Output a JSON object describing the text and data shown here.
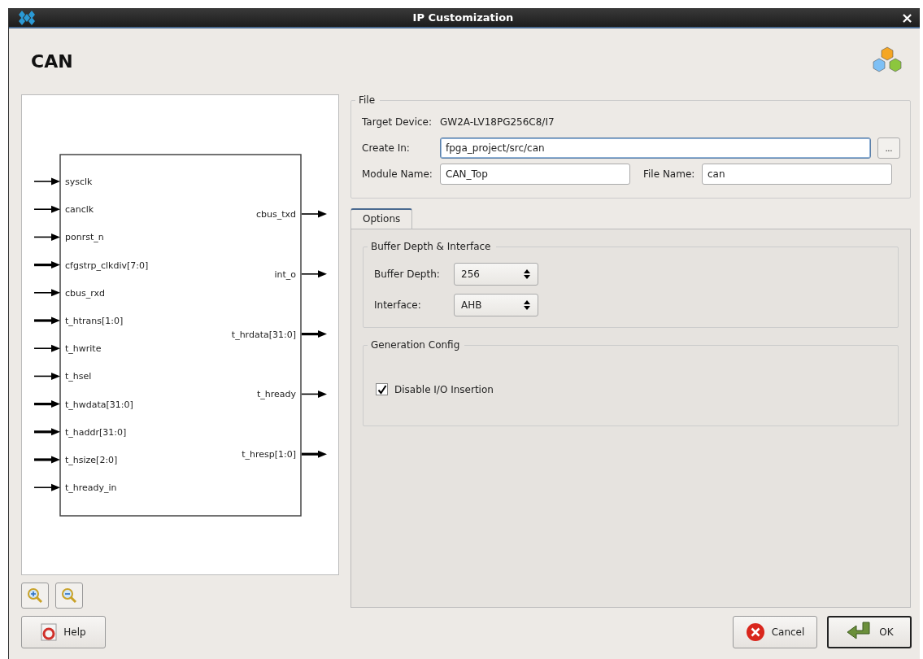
{
  "window": {
    "title": "IP Customization",
    "close": "×"
  },
  "header": {
    "title": "CAN"
  },
  "diagram": {
    "inputs": [
      {
        "name": "sysclk",
        "kind": "wire"
      },
      {
        "name": "canclk",
        "kind": "wire"
      },
      {
        "name": "ponrst_n",
        "kind": "wire"
      },
      {
        "name": "cfgstrp_clkdiv[7:0]",
        "kind": "bus"
      },
      {
        "name": "cbus_rxd",
        "kind": "wire"
      },
      {
        "name": "t_htrans[1:0]",
        "kind": "bus"
      },
      {
        "name": "t_hwrite",
        "kind": "wire"
      },
      {
        "name": "t_hsel",
        "kind": "wire"
      },
      {
        "name": "t_hwdata[31:0]",
        "kind": "bus"
      },
      {
        "name": "t_haddr[31:0]",
        "kind": "bus"
      },
      {
        "name": "t_hsize[2:0]",
        "kind": "bus"
      },
      {
        "name": "t_hready_in",
        "kind": "wire"
      }
    ],
    "outputs": [
      {
        "name": "cbus_txd",
        "kind": "wire"
      },
      {
        "name": "int_o",
        "kind": "wire"
      },
      {
        "name": "t_hrdata[31:0]",
        "kind": "bus"
      },
      {
        "name": "t_hready",
        "kind": "wire"
      },
      {
        "name": "t_hresp[1:0]",
        "kind": "bus"
      }
    ]
  },
  "file": {
    "legend": "File",
    "target_device_label": "Target Device:",
    "target_device": "GW2A-LV18PG256C8/I7",
    "create_in_label": "Create In:",
    "create_in": "fpga_project/src/can",
    "browse": "...",
    "module_name_label": "Module Name:",
    "module_name": "CAN_Top",
    "file_name_label": "File Name:",
    "file_name": "can"
  },
  "tabs": [
    {
      "label": "Options",
      "selected": true
    }
  ],
  "buffer_group": {
    "legend": "Buffer Depth & Interface",
    "buffer_depth_label": "Buffer Depth:",
    "buffer_depth": "256",
    "interface_label": "Interface:",
    "interface": "AHB"
  },
  "generation_group": {
    "legend": "Generation Config",
    "disable_io_insertion": {
      "label": "Disable I/O Insertion",
      "checked": true
    }
  },
  "buttons": {
    "help": "Help",
    "cancel": "Cancel",
    "ok": "OK"
  }
}
